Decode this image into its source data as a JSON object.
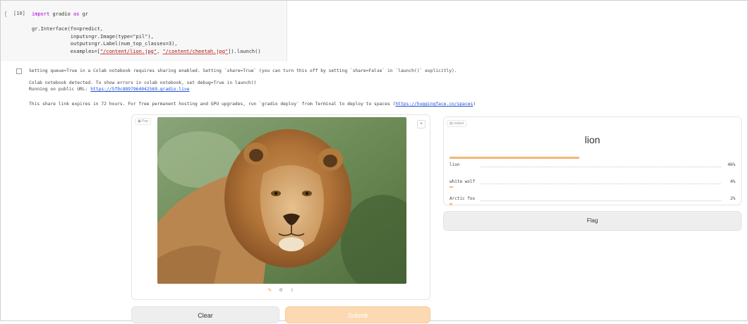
{
  "cell": {
    "exec_count": "[10]",
    "line1_kw": "import",
    "line1_mod": "gradio",
    "line1_as": "as",
    "line1_alias": "gr",
    "line2": "gr.Interface(fn=predict,",
    "line3": "inputs=gr.Image(type=\"pil\"),",
    "line4": "outputs=gr.Label(num_top_classes=3),",
    "line5_pre": "examples=[",
    "line5_ex1": "\"/content/lion.jpg\"",
    "line5_sep": ", ",
    "line5_ex2": "\"/content/cheetah.jpg\"",
    "line5_post": "]).launch()"
  },
  "output": {
    "line1": "Setting queue=True in a Colab notebook requires sharing enabled. Setting `share=True` (you can turn this off by setting `share=False` in `launch()` explicitly).",
    "line2": "Colab notebook detected. To show errors in colab notebook, set debug=True in launch()",
    "line3_prefix": "Running on public URL: ",
    "line3_link": "https://5f9c8897964042569.gradio.live",
    "line4_prefix": "This share link expires in 72 hours. For free permanent hosting and GPU upgrades, run `gradio deploy` from Terminal to deploy to spaces (",
    "line4_link": "https://huggingface.co/spaces",
    "line4_suffix": ")"
  },
  "input_panel": {
    "label": "Pnp",
    "close": "×",
    "tool_icons": [
      "edit-icon",
      "clear-icon",
      "download-icon"
    ]
  },
  "output_panel": {
    "label": "output",
    "top_label": "lion",
    "top_confidence": 0.46,
    "confidences": [
      {
        "label": "lion",
        "pct": "46%",
        "value": 0.46
      },
      {
        "label": "white wolf",
        "pct": "4%",
        "value": 0.04
      },
      {
        "label": "Arctic fox",
        "pct": "2%",
        "value": 0.02
      }
    ]
  },
  "buttons": {
    "clear": "Clear",
    "submit": "Submit",
    "flag": "Flag"
  },
  "colors": {
    "accent": "#f4b57a",
    "submit_bg": "#fcd9b2",
    "link": "#1a4fd6"
  }
}
